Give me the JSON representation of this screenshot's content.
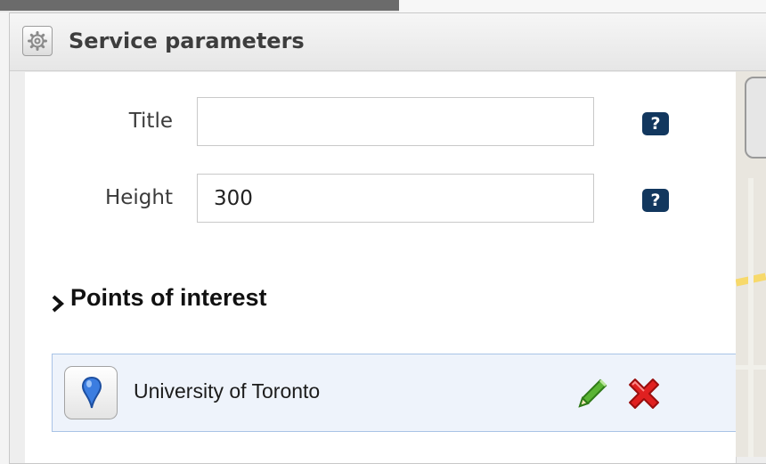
{
  "window": {
    "title": "Service parameters",
    "icon": "gear-icon"
  },
  "form": {
    "title_label": "Title",
    "title_value": "",
    "height_label": "Height",
    "height_value": "300",
    "help_glyph": "?"
  },
  "points_section": {
    "title": "Points of interest",
    "items": [
      {
        "label": "University of Toronto",
        "icon": "map-pin-icon"
      }
    ]
  },
  "colors": {
    "help_icon_bg": "#12375e",
    "row_highlight": "#eef3fb",
    "pin": "#3b7de0",
    "edit": "#5ab434",
    "delete": "#e02020"
  }
}
